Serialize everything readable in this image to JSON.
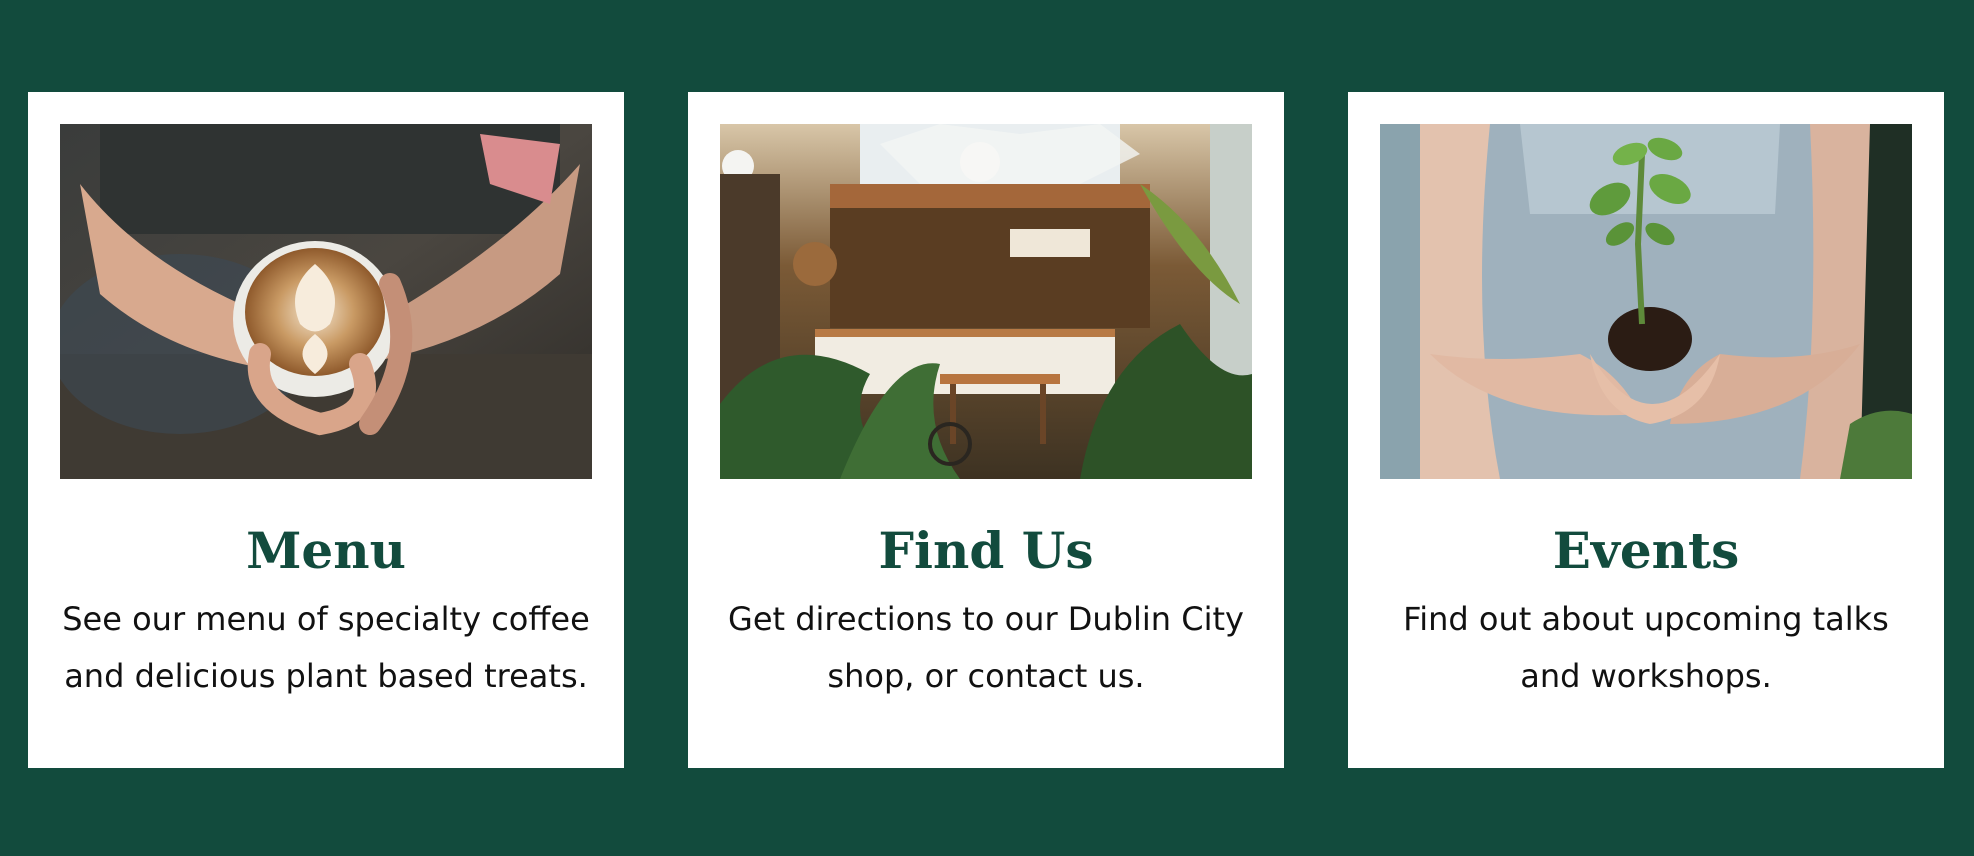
{
  "cards": [
    {
      "title": "Menu",
      "text": "See our menu of specialty coffee and delicious plant based treats.",
      "image": "latte-art-photo"
    },
    {
      "title": "Find Us",
      "text": "Get directions to our Dublin City shop, or contact us.",
      "image": "cafe-interior-photo"
    },
    {
      "title": "Events",
      "text": "Find out about upcoming talks and workshops.",
      "image": "seedling-in-hands-photo"
    }
  ],
  "colors": {
    "background": "#124b3d",
    "card": "#ffffff",
    "title": "#124b3d",
    "text": "#111111"
  }
}
